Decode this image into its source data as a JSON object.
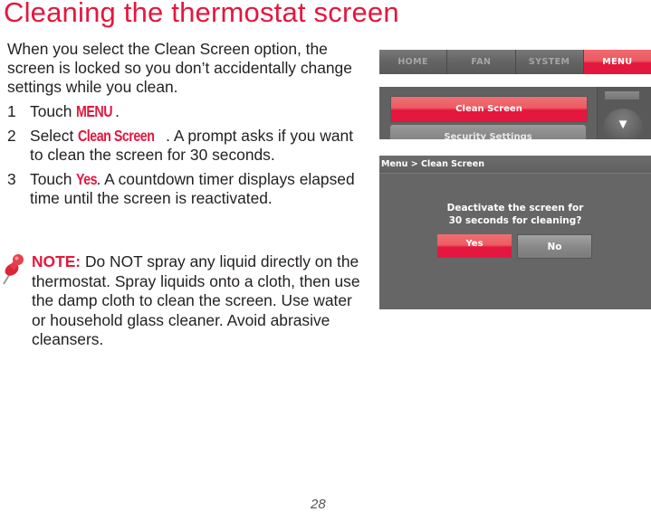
{
  "page": {
    "title": "Cleaning the thermostat screen",
    "intro": "When you select the Clean Screen option, the screen is locked so you don’t accidentally change settings while you clean.",
    "steps": [
      {
        "number": "1",
        "before": "Touch ",
        "highlight": "MENU",
        "after": "."
      },
      {
        "number": "2",
        "before": "Select ",
        "highlight": "Clean Screen",
        "after": ". A prompt asks if you want to clean the screen for 30 seconds."
      },
      {
        "number": "3",
        "before": "Touch ",
        "highlight": "Yes",
        "after": ". A countdown timer displays elapsed time until the screen is reactivated."
      }
    ],
    "note": {
      "label": "NOTE:",
      "text": " Do NOT spray any liquid directly on the thermostat. Spray liquids onto a cloth, then use the damp cloth to clean the screen. Use water or household glass cleaner. Avoid abrasive cleansers.",
      "icon": "pushpin-icon"
    },
    "page_number": "28"
  },
  "thermostat_menu": {
    "tabs": [
      {
        "label": "HOME",
        "active": false
      },
      {
        "label": "FAN",
        "active": false
      },
      {
        "label": "SYSTEM",
        "active": false
      },
      {
        "label": "MENU",
        "active": true
      }
    ],
    "items": [
      {
        "label": "Clean Screen",
        "selected": true
      },
      {
        "label": "Security Settings",
        "selected": false
      }
    ],
    "scroll_down_icon": "▼"
  },
  "thermostat_dialog": {
    "breadcrumb": "Menu > Clean Screen",
    "prompt_line1": "Deactivate the screen for",
    "prompt_line2": "30 seconds for cleaning?",
    "yes_label": "Yes",
    "no_label": "No"
  },
  "colors": {
    "accent": "#e4173e",
    "panel_gray": "#676666",
    "text": "#231f20"
  }
}
